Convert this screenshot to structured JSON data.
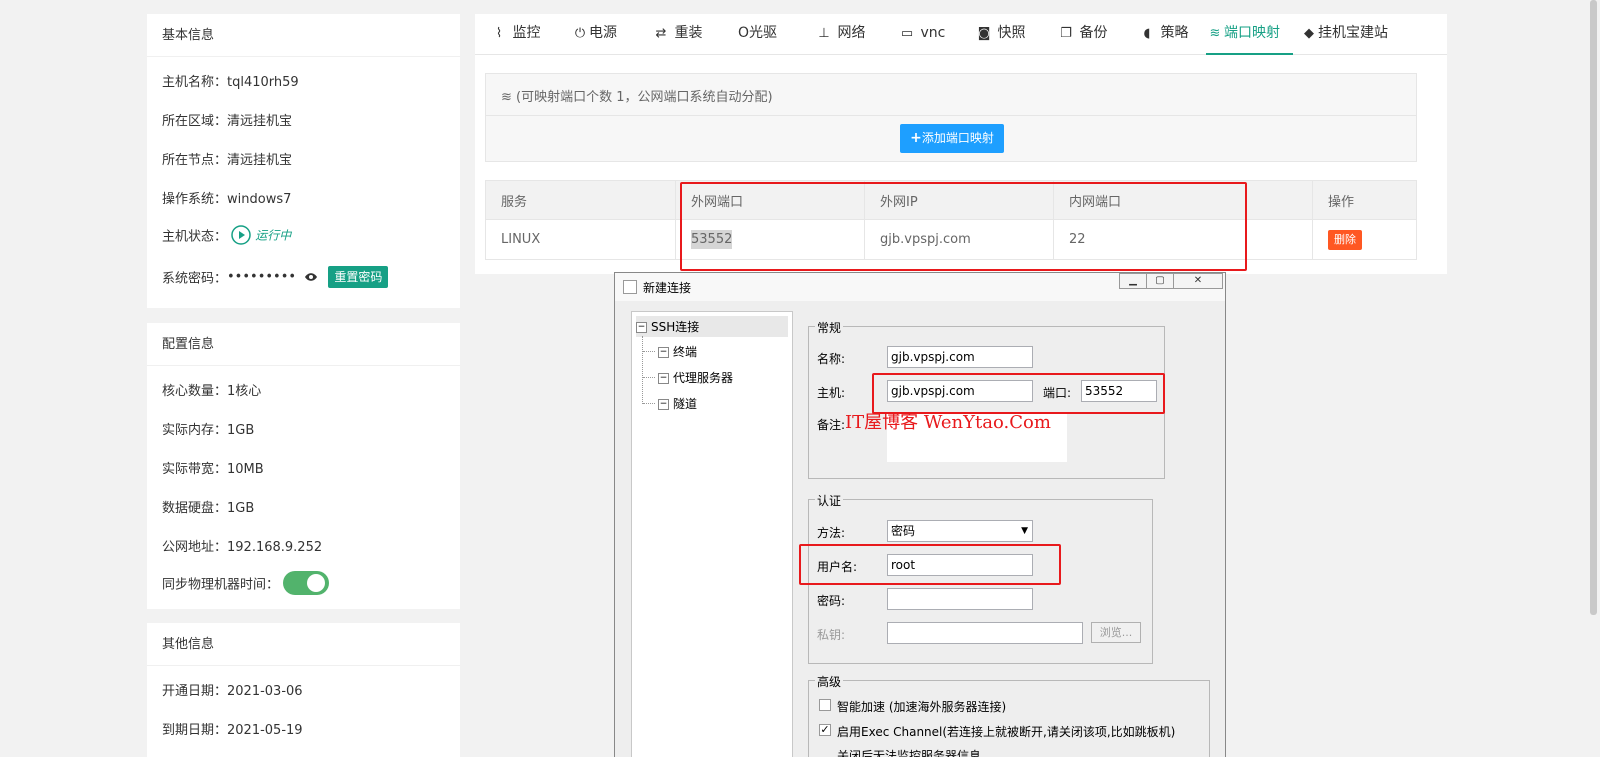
{
  "basic_info": {
    "title": "基本信息",
    "hostname": "主机名称：tql410rh59",
    "region": "所在区域：清远挂机宝",
    "node": "所在节点：清远挂机宝",
    "os": "操作系统：windows7",
    "status_label": "主机状态：",
    "status_value": "运行中",
    "password_label": "系统密码：",
    "password_value": "•••••••••",
    "reset_password": "重置密码"
  },
  "config_info": {
    "title": "配置信息",
    "cores": "核心数量：1核心",
    "memory": "实际内存：1GB",
    "bandwidth": "实际带宽：10MB",
    "disk": "数据硬盘：1GB",
    "public_ip": "公网地址：192.168.9.252",
    "sync_time_label": "同步物理机器时间："
  },
  "other_info": {
    "title": "其他信息",
    "open_date": "开通日期：2021-03-06",
    "expire_date": "到期日期：2021-05-19"
  },
  "tabs": [
    {
      "icon": "chart-line-icon",
      "glyph": "⌇",
      "label": "监控"
    },
    {
      "icon": "power-icon",
      "glyph": "⏻",
      "label": "电源"
    },
    {
      "icon": "retweet-icon",
      "glyph": "⇄",
      "label": "重装"
    },
    {
      "icon": "disc-icon",
      "glyph": "",
      "label": "O光驱"
    },
    {
      "icon": "sitemap-icon",
      "glyph": "⊥",
      "label": "网络"
    },
    {
      "icon": "monitor-icon",
      "glyph": "▭",
      "label": "vnc"
    },
    {
      "icon": "camera-icon",
      "glyph": "◙",
      "label": "快照"
    },
    {
      "icon": "copy-icon",
      "glyph": "❐",
      "label": "备份"
    },
    {
      "icon": "shield-icon",
      "glyph": "◖",
      "label": "策略"
    },
    {
      "icon": "wifi-icon",
      "glyph": "≋",
      "label": "端口映射"
    },
    {
      "icon": "cube-icon",
      "glyph": "◆",
      "label": "挂机宝建站"
    }
  ],
  "port_map": {
    "notice": "(可映射端口个数 1，公网端口系统自动分配)",
    "add_button": "添加端口映射",
    "columns": [
      "服务",
      "外网端口",
      "外网IP",
      "内网端口",
      "操作"
    ],
    "rows": [
      {
        "service": "LINUX",
        "ext_port": "53552",
        "ext_ip": "gjb.vpspj.com",
        "int_port": "22",
        "action": "删除"
      }
    ]
  },
  "dialog": {
    "title": "新建连接",
    "tree": {
      "root": "SSH连接",
      "children": [
        "终端",
        "代理服务器",
        "隧道"
      ]
    },
    "general": {
      "legend": "常规",
      "name_label": "名称:",
      "name_value": "gjb.vpspj.com",
      "host_label": "主机:",
      "host_value": "gjb.vpspj.com",
      "port_label": "端口:",
      "port_value": "53552",
      "note_label": "备注:"
    },
    "auth": {
      "legend": "认证",
      "method_label": "方法:",
      "method_value": "密码",
      "user_label": "用户名:",
      "user_value": "root",
      "pass_label": "密码:",
      "pass_value": "",
      "key_label": "私钥:",
      "key_value": "",
      "browse": "浏览..."
    },
    "advanced": {
      "legend": "高级",
      "opt1": "智能加速 (加速海外服务器连接)",
      "opt2": "启用Exec Channel(若连接上就被断开,请关闭该项,比如跳板机)",
      "opt3": "关闭后无法监控服务器信息"
    }
  },
  "watermark": "IT屋博客 WenYtao.Com",
  "colors": {
    "accent": "#16a085",
    "primary": "#1e9fff",
    "danger": "#ff5722",
    "highlight_box": "#e8191c"
  }
}
